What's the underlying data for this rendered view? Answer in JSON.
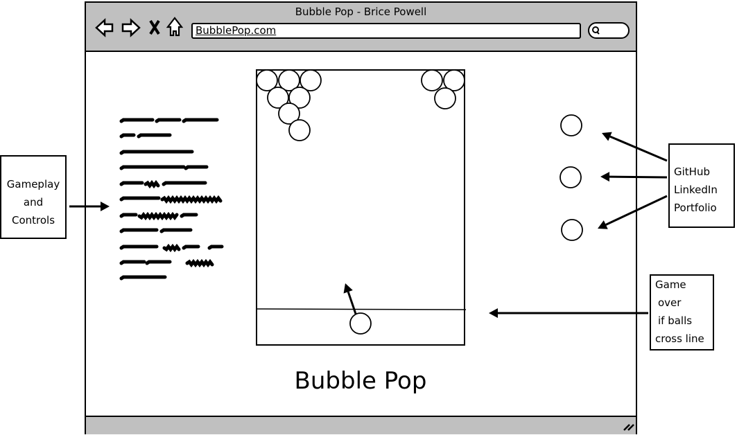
{
  "browser": {
    "window_title": "Bubble Pop - Brice Powell",
    "url": "BubblePop.com",
    "icons": [
      "back-arrow-icon",
      "forward-arrow-icon",
      "close-x-icon",
      "home-icon",
      "search-icon",
      "resize-grip-icon"
    ]
  },
  "page": {
    "heading": "Bubble Pop",
    "instructions_placeholder_lines": 11,
    "link_buttons_count": 3
  },
  "annotations": {
    "gameplay": [
      "Gameplay",
      "and",
      "Controls"
    ],
    "links": [
      "GitHub",
      "LinkedIn",
      "Portfolio"
    ],
    "game_over": [
      "Game",
      "over",
      "if balls",
      "cross line"
    ]
  }
}
